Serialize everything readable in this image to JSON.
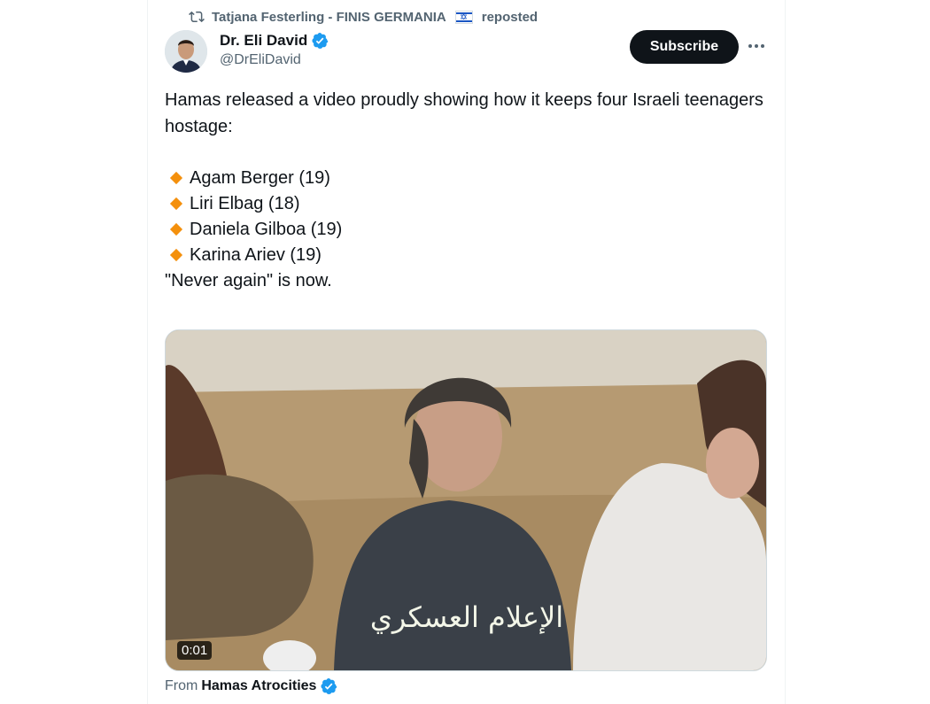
{
  "repost": {
    "icon": "repost-icon",
    "user": "Tatjana Festerling - FINIS GERMANIA",
    "flag": "israel-flag-emoji",
    "suffix": "reposted"
  },
  "author": {
    "name": "Dr. Eli David",
    "handle": "@DrEliDavid",
    "verified_icon": "verified-badge-icon",
    "verified_color": "#1d9bf0"
  },
  "actions": {
    "subscribe_label": "Subscribe",
    "more_icon": "more-icon"
  },
  "tweet": {
    "intro": "Hamas released a video proudly showing how it keeps four Israeli teenagers hostage:",
    "list": [
      "Agam Berger (19)",
      "Liri Elbag (18)",
      "Daniela Gilboa (19)",
      "Karina Ariev (19)"
    ],
    "bullet_color": "#f4900c",
    "closing": "\"Never again\" is now."
  },
  "media": {
    "duration": "0:01",
    "caption_overlay": "الإعلام العسكري"
  },
  "source": {
    "prefix": "From",
    "account": "Hamas Atrocities"
  },
  "colors": {
    "text": "#0f1419",
    "secondary": "#536471",
    "button": "#0f1419",
    "border": "#cfd9de"
  }
}
